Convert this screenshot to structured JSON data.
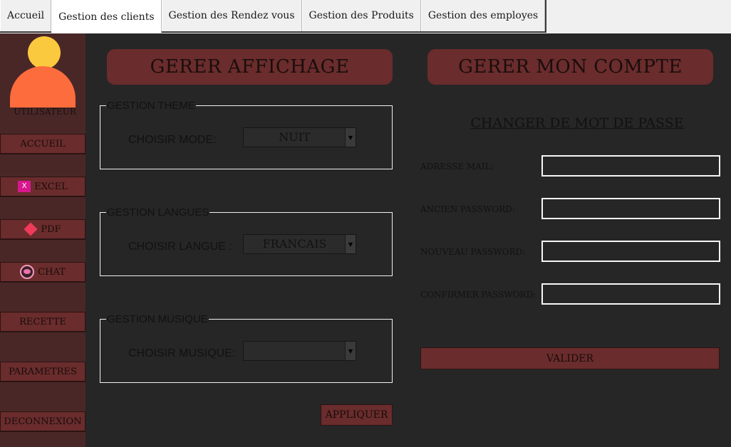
{
  "tabs": [
    {
      "label": "Accueil",
      "active": false
    },
    {
      "label": "Gestion des clients",
      "active": true
    },
    {
      "label": "Gestion des Rendez vous",
      "active": false
    },
    {
      "label": "Gestion des Produits",
      "active": false
    },
    {
      "label": "Gestion des employes",
      "active": false
    }
  ],
  "sidebar": {
    "avatar_icon": "user-avatar-icon",
    "user_label": "UTILISATEUR",
    "items": [
      {
        "label": "ACCUEIL"
      },
      {
        "label": "EXCEL",
        "icon": "excel-icon"
      },
      {
        "label": "PDF",
        "icon": "pdf-icon"
      },
      {
        "label": "CHAT",
        "icon": "chat-icon"
      },
      {
        "label": "RECETTE"
      },
      {
        "label": "PARAMETRES"
      },
      {
        "label": "DECONNEXION"
      }
    ]
  },
  "display": {
    "title": "GERER AFFICHAGE",
    "theme": {
      "legend": "GESTION THEME",
      "label": "CHOISIR MODE:",
      "value": "NUIT"
    },
    "language": {
      "legend": "GESTION LANGUES",
      "label": "CHOISIR LANGUE :",
      "value": "FRANCAIS"
    },
    "music": {
      "legend": "GESTION MUSIQUE",
      "label": "CHOISIR MUSIQUE:",
      "value": ""
    },
    "apply_label": "APPLIQUER"
  },
  "account": {
    "title": "GERER MON COMPTE",
    "subtitle": "CHANGER DE MOT DE PASSE",
    "fields": [
      {
        "label": "ADRESSE MAIL:",
        "value": ""
      },
      {
        "label": "ANCIEN PASSWORD:",
        "value": ""
      },
      {
        "label": "NOUVEAU PASSWORD:",
        "value": ""
      },
      {
        "label": "CONFIRMER PASSWORD:",
        "value": ""
      }
    ],
    "submit_label": "VALIDER"
  },
  "colors": {
    "background": "#262626",
    "sidebar": "#4a2727",
    "accent": "#6a2c2c",
    "avatar_head": "#fbc93d",
    "avatar_body": "#fd6c3c"
  }
}
